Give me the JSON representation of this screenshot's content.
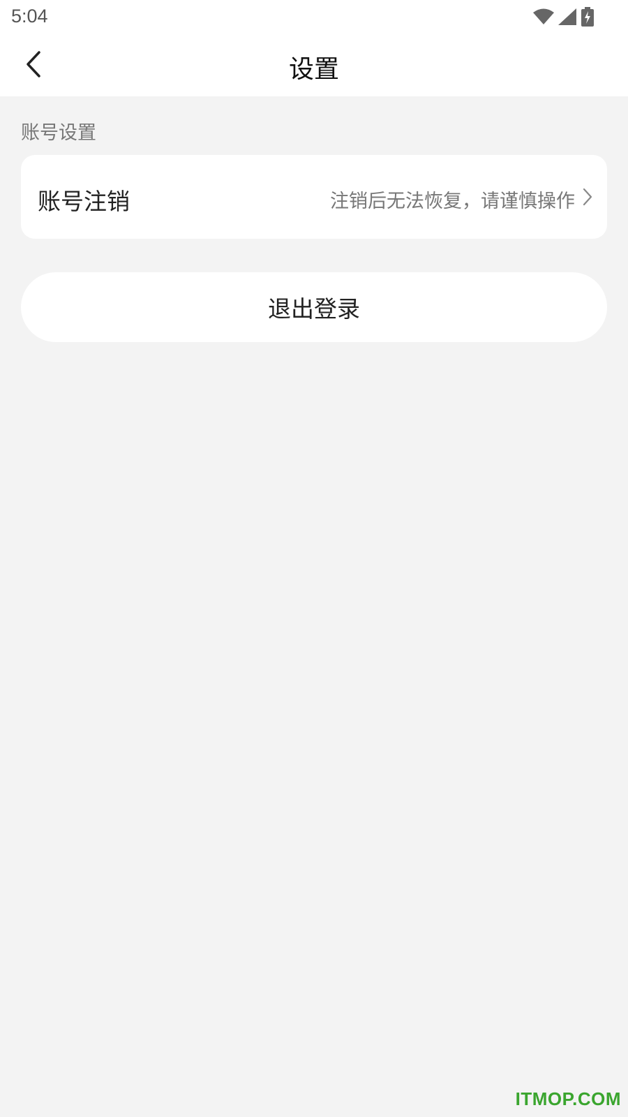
{
  "status_bar": {
    "time": "5:04",
    "icons": [
      "wifi-icon",
      "signal-icon",
      "battery-charging-icon"
    ]
  },
  "nav": {
    "back_icon": "chevron-left-icon",
    "title": "设置"
  },
  "account_section": {
    "title": "账号设置",
    "items": [
      {
        "label": "账号注销",
        "hint": "注销后无法恢复，请谨慎操作",
        "icon": "chevron-right-icon"
      }
    ]
  },
  "logout": {
    "label": "退出登录"
  },
  "watermark": {
    "text": "ITMOP.COM"
  },
  "colors": {
    "background": "#f3f3f3",
    "card": "#ffffff",
    "watermark": "#3aa52e"
  }
}
